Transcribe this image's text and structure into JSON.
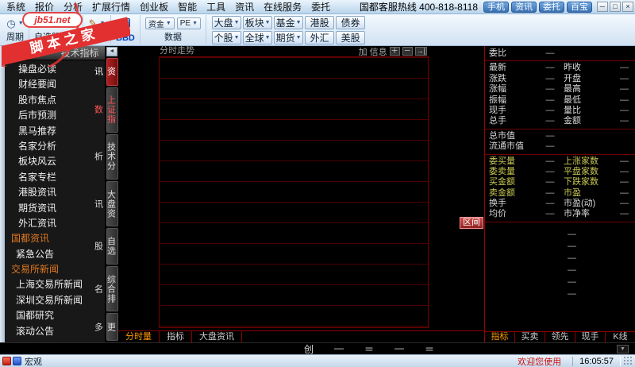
{
  "watermark": {
    "site": "jb51.net",
    "name": "脚本之家"
  },
  "menubar": {
    "items": [
      "系统",
      "报价",
      "分析",
      "扩展行情",
      "创业板",
      "智能",
      "工具",
      "资讯",
      "在线服务",
      "委托"
    ],
    "hotline": "国都客服热线 400-818-8118",
    "quick_buttons": [
      "手机",
      "资讯",
      "委托",
      "百宝"
    ],
    "window_buttons": [
      "─",
      "□",
      "×"
    ]
  },
  "toolbar": {
    "group_labels": [
      "周期",
      "自选股 F10",
      "画线",
      "BBD",
      "数据"
    ],
    "dropdown_buttons": [
      "资金",
      "PE"
    ],
    "market_rows": [
      [
        {
          "label": "大盘",
          "arrow": true
        },
        {
          "label": "板块",
          "arrow": true
        },
        {
          "label": "基金",
          "arrow": true
        },
        {
          "label": "港股",
          "arrow": false
        },
        {
          "label": "债券",
          "arrow": false
        }
      ],
      [
        {
          "label": "个股",
          "arrow": true
        },
        {
          "label": "全球",
          "arrow": true
        },
        {
          "label": "期货",
          "arrow": true
        },
        {
          "label": "外汇",
          "arrow": false
        },
        {
          "label": "美股",
          "arrow": false
        }
      ]
    ]
  },
  "sidebar": {
    "tabs": [
      "资讯",
      "技术指标"
    ],
    "items": [
      {
        "label": "操盘必读",
        "type": "item"
      },
      {
        "label": "财经要闻",
        "type": "item"
      },
      {
        "label": "股市焦点",
        "type": "item"
      },
      {
        "label": "后市预测",
        "type": "item"
      },
      {
        "label": "黑马推荐",
        "type": "item"
      },
      {
        "label": "名家分析",
        "type": "item"
      },
      {
        "label": "板块风云",
        "type": "item"
      },
      {
        "label": "名家专栏",
        "type": "item"
      },
      {
        "label": "港股资讯",
        "type": "item"
      },
      {
        "label": "期货资讯",
        "type": "item"
      },
      {
        "label": "外汇资讯",
        "type": "item"
      },
      {
        "label": "国都资讯",
        "type": "header"
      },
      {
        "label": "紧急公告",
        "type": "sub"
      },
      {
        "label": "交易所新闻",
        "type": "header"
      },
      {
        "label": "上海交易所新闻",
        "type": "sub"
      },
      {
        "label": "深圳交易所新闻",
        "type": "sub"
      },
      {
        "label": "国都研究",
        "type": "sub"
      },
      {
        "label": "滚动公告",
        "type": "sub"
      }
    ]
  },
  "vtabs": [
    {
      "label": "资讯",
      "active": true
    },
    {
      "label": "上证指数",
      "accent": true
    },
    {
      "label": "技术分析"
    },
    {
      "label": "大盘资讯"
    },
    {
      "label": "自选股"
    },
    {
      "label": "综合排名"
    },
    {
      "label": "更多"
    }
  ],
  "chart": {
    "title": "分时走势",
    "controls": [
      "加",
      "信息",
      "＋",
      "－",
      "→|"
    ],
    "range_button": "区间",
    "footer_tabs": [
      "分时量",
      "指标",
      "大盘资讯"
    ]
  },
  "quote_panel": {
    "rows": [
      {
        "l1": "委比",
        "v1": "—",
        "l2": "",
        "v2": ""
      },
      {
        "l1": "最新",
        "v1": "—",
        "l2": "昨收",
        "v2": "—"
      },
      {
        "l1": "涨跌",
        "v1": "—",
        "l2": "开盘",
        "v2": "—"
      },
      {
        "l1": "涨幅",
        "v1": "—",
        "l2": "最高",
        "v2": "—"
      },
      {
        "l1": "振幅",
        "v1": "—",
        "l2": "最低",
        "v2": "—"
      },
      {
        "l1": "现手",
        "v1": "—",
        "l2": "量比",
        "v2": "—"
      },
      {
        "l1": "总手",
        "v1": "—",
        "l2": "金额",
        "v2": "—"
      },
      {
        "l1": "总市值",
        "v1": "—",
        "l2": "",
        "v2": ""
      },
      {
        "l1": "流通市值",
        "v1": "—",
        "l2": "",
        "v2": ""
      },
      {
        "l1": "委买量",
        "v1": "—",
        "l2": "上涨家数",
        "v2": "—",
        "accent": true
      },
      {
        "l1": "委卖量",
        "v1": "—",
        "l2": "平盘家数",
        "v2": "—",
        "accent": true
      },
      {
        "l1": "买金额",
        "v1": "—",
        "l2": "下跌家数",
        "v2": "—",
        "accent": true
      },
      {
        "l1": "卖金额",
        "v1": "—",
        "l2": "市盈",
        "v2": "—",
        "accent": true
      },
      {
        "l1": "换手",
        "v1": "—",
        "l2": "市盈(动)",
        "v2": "—"
      },
      {
        "l1": "均价",
        "v1": "—",
        "l2": "市净率",
        "v2": "—"
      }
    ],
    "dash_rows": [
      "—",
      "—",
      "—",
      "—",
      "—",
      "—"
    ],
    "footer_tabs": [
      "指标",
      "买卖",
      "领先",
      "现手",
      "K线"
    ]
  },
  "ticker": {
    "items": [
      "创",
      "—",
      "＝",
      "—",
      "＝"
    ]
  },
  "statusbar": {
    "left_label": "宏观",
    "welcome": "欢迎您使用",
    "time": "16:05:57"
  }
}
